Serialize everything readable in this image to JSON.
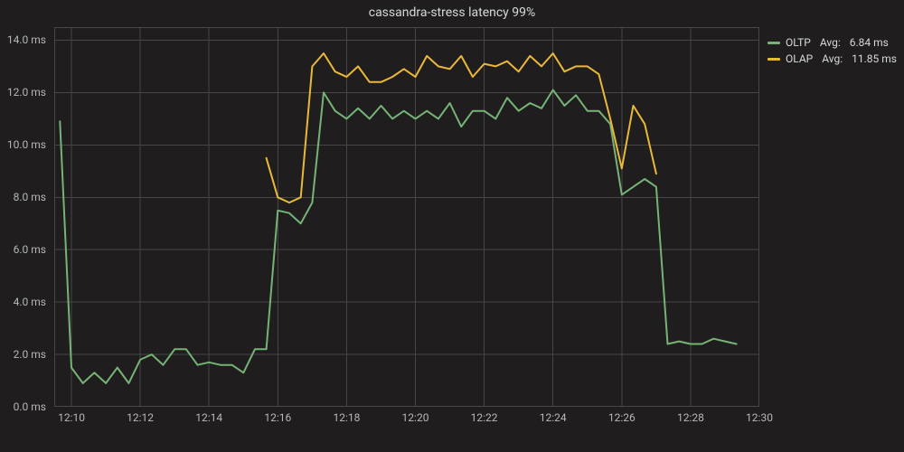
{
  "title": "cassandra-stress latency 99%",
  "colors": {
    "oltp": "#76b376",
    "olap": "#eab839"
  },
  "legend": {
    "oltp_name": "OLTP",
    "oltp_stat_label": "Avg:",
    "oltp_stat_value": "6.84 ms",
    "olap_name": "OLAP",
    "olap_stat_label": "Avg:",
    "olap_stat_value": "11.85 ms"
  },
  "y_unit": "ms",
  "y_ticks": [
    0,
    2,
    4,
    6,
    8,
    10,
    12,
    14
  ],
  "x_ticks": [
    "12:10",
    "12:12",
    "12:14",
    "12:16",
    "12:18",
    "12:20",
    "12:22",
    "12:24",
    "12:26",
    "12:28",
    "12:30"
  ],
  "chart_data": {
    "type": "line",
    "title": "cassandra-stress latency 99%",
    "xlabel": "",
    "ylabel": "",
    "ylim": [
      0,
      14.5
    ],
    "xlim": [
      "12:09:30",
      "12:30:00"
    ],
    "x_tick_labels": [
      "12:10",
      "12:12",
      "12:14",
      "12:16",
      "12:18",
      "12:20",
      "12:22",
      "12:24",
      "12:26",
      "12:28",
      "12:30"
    ],
    "grid": true,
    "legend_position": "right",
    "series": [
      {
        "name": "OLTP",
        "color": "#76b376",
        "avg": 6.84,
        "x": [
          "12:09:40",
          "12:10:00",
          "12:10:20",
          "12:10:40",
          "12:11:00",
          "12:11:20",
          "12:11:40",
          "12:12:00",
          "12:12:20",
          "12:12:40",
          "12:13:00",
          "12:13:20",
          "12:13:40",
          "12:14:00",
          "12:14:20",
          "12:14:40",
          "12:15:00",
          "12:15:20",
          "12:15:40",
          "12:16:00",
          "12:16:20",
          "12:16:40",
          "12:17:00",
          "12:17:20",
          "12:17:40",
          "12:18:00",
          "12:18:20",
          "12:18:40",
          "12:19:00",
          "12:19:20",
          "12:19:40",
          "12:20:00",
          "12:20:20",
          "12:20:40",
          "12:21:00",
          "12:21:20",
          "12:21:40",
          "12:22:00",
          "12:22:20",
          "12:22:40",
          "12:23:00",
          "12:23:20",
          "12:23:40",
          "12:24:00",
          "12:24:20",
          "12:24:40",
          "12:25:00",
          "12:25:20",
          "12:25:40",
          "12:26:00",
          "12:26:20",
          "12:26:40",
          "12:27:00",
          "12:27:20",
          "12:27:40",
          "12:28:00",
          "12:28:20",
          "12:28:40",
          "12:29:00",
          "12:29:20"
        ],
        "values": [
          10.9,
          1.5,
          0.9,
          1.3,
          0.9,
          1.5,
          0.9,
          1.8,
          2.0,
          1.6,
          2.2,
          2.2,
          1.6,
          1.7,
          1.6,
          1.6,
          1.3,
          2.2,
          2.2,
          7.5,
          7.4,
          7.0,
          7.8,
          12.0,
          11.3,
          11.0,
          11.4,
          11.0,
          11.5,
          11.0,
          11.3,
          11.0,
          11.3,
          11.0,
          11.6,
          10.7,
          11.3,
          11.3,
          11.0,
          11.8,
          11.3,
          11.6,
          11.4,
          12.1,
          11.5,
          11.9,
          11.3,
          11.3,
          10.8,
          8.1,
          8.4,
          8.7,
          8.4,
          2.4,
          2.5,
          2.4,
          2.4,
          2.6,
          2.5,
          2.4
        ]
      },
      {
        "name": "OLAP",
        "color": "#eab839",
        "avg": 11.85,
        "x": [
          "12:15:40",
          "12:16:00",
          "12:16:20",
          "12:16:40",
          "12:17:00",
          "12:17:20",
          "12:17:40",
          "12:18:00",
          "12:18:20",
          "12:18:40",
          "12:19:00",
          "12:19:20",
          "12:19:40",
          "12:20:00",
          "12:20:20",
          "12:20:40",
          "12:21:00",
          "12:21:20",
          "12:21:40",
          "12:22:00",
          "12:22:20",
          "12:22:40",
          "12:23:00",
          "12:23:20",
          "12:23:40",
          "12:24:00",
          "12:24:20",
          "12:24:40",
          "12:25:00",
          "12:25:20",
          "12:25:40",
          "12:26:00",
          "12:26:20",
          "12:26:40",
          "12:27:00"
        ],
        "values": [
          9.5,
          8.0,
          7.8,
          8.0,
          13.0,
          13.5,
          12.8,
          12.6,
          13.0,
          12.4,
          12.4,
          12.6,
          12.9,
          12.6,
          13.4,
          13.0,
          12.9,
          13.4,
          12.6,
          13.1,
          13.0,
          13.2,
          12.8,
          13.4,
          13.0,
          13.5,
          12.8,
          13.0,
          13.0,
          12.7,
          11.0,
          9.1,
          11.5,
          10.8,
          8.9
        ]
      }
    ]
  }
}
